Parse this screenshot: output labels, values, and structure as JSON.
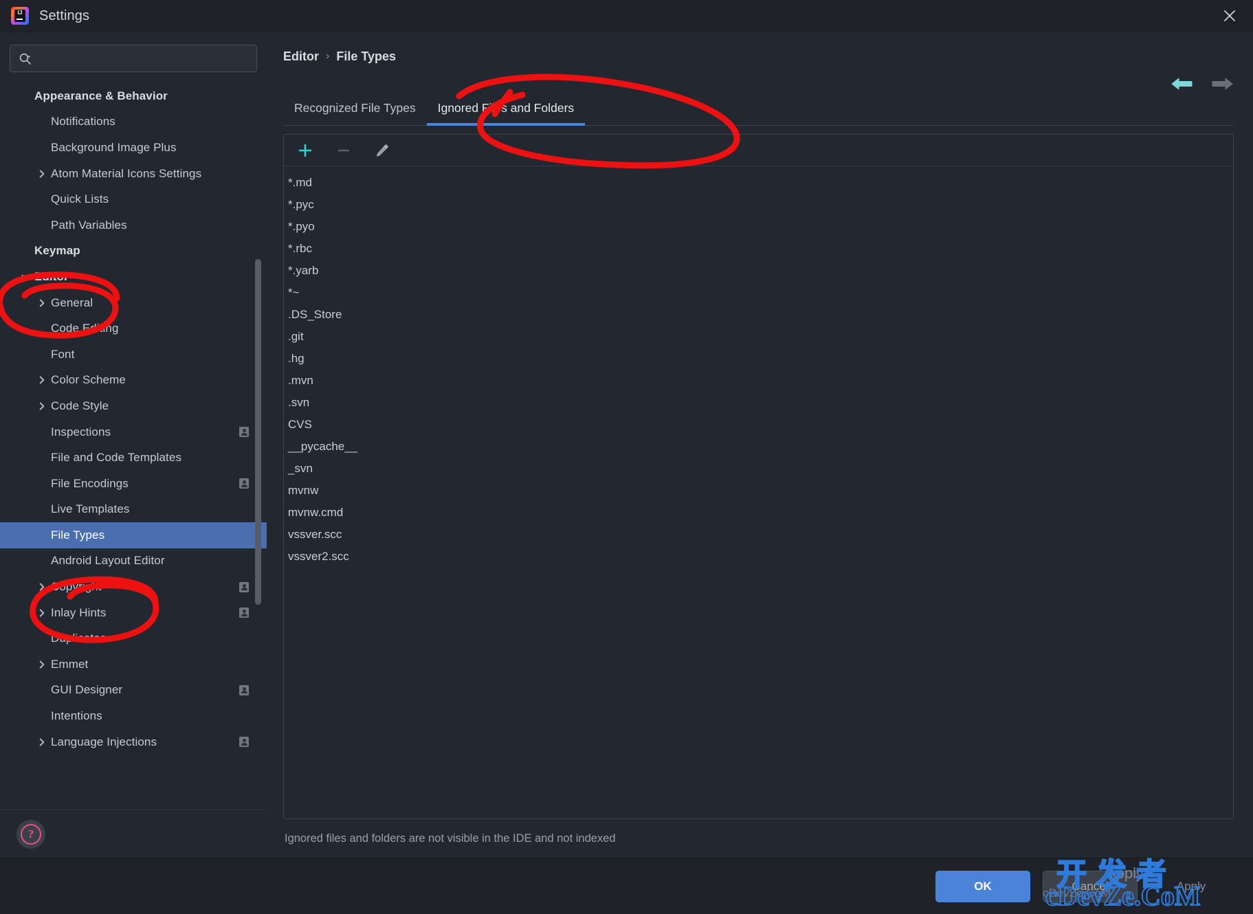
{
  "window": {
    "title": "Settings",
    "logo_icon": "intellij-idea-logo",
    "close_icon": "close-icon"
  },
  "search": {
    "placeholder": "",
    "value": "",
    "icon": "search-icon"
  },
  "sidebar": {
    "items": [
      {
        "label": "Appearance & Behavior",
        "level": 0,
        "arrow": "none",
        "group": true,
        "badge": false,
        "selected": false
      },
      {
        "label": "Notifications",
        "level": 1,
        "arrow": "none",
        "group": false,
        "badge": false,
        "selected": false
      },
      {
        "label": "Background Image Plus",
        "level": 1,
        "arrow": "none",
        "group": false,
        "badge": false,
        "selected": false
      },
      {
        "label": "Atom Material Icons Settings",
        "level": 1,
        "arrow": "collapsed",
        "group": false,
        "badge": false,
        "selected": false
      },
      {
        "label": "Quick Lists",
        "level": 1,
        "arrow": "none",
        "group": false,
        "badge": false,
        "selected": false
      },
      {
        "label": "Path Variables",
        "level": 1,
        "arrow": "none",
        "group": false,
        "badge": false,
        "selected": false
      },
      {
        "label": "Keymap",
        "level": 0,
        "arrow": "none",
        "group": true,
        "badge": false,
        "selected": false
      },
      {
        "label": "Editor",
        "level": 0,
        "arrow": "expanded",
        "group": true,
        "badge": false,
        "selected": false
      },
      {
        "label": "General",
        "level": 1,
        "arrow": "collapsed",
        "group": false,
        "badge": false,
        "selected": false
      },
      {
        "label": "Code Editing",
        "level": 1,
        "arrow": "none",
        "group": false,
        "badge": false,
        "selected": false
      },
      {
        "label": "Font",
        "level": 1,
        "arrow": "none",
        "group": false,
        "badge": false,
        "selected": false
      },
      {
        "label": "Color Scheme",
        "level": 1,
        "arrow": "collapsed",
        "group": false,
        "badge": false,
        "selected": false
      },
      {
        "label": "Code Style",
        "level": 1,
        "arrow": "collapsed",
        "group": false,
        "badge": false,
        "selected": false
      },
      {
        "label": "Inspections",
        "level": 1,
        "arrow": "none",
        "group": false,
        "badge": true,
        "selected": false
      },
      {
        "label": "File and Code Templates",
        "level": 1,
        "arrow": "none",
        "group": false,
        "badge": false,
        "selected": false
      },
      {
        "label": "File Encodings",
        "level": 1,
        "arrow": "none",
        "group": false,
        "badge": true,
        "selected": false
      },
      {
        "label": "Live Templates",
        "level": 1,
        "arrow": "none",
        "group": false,
        "badge": false,
        "selected": false
      },
      {
        "label": "File Types",
        "level": 1,
        "arrow": "none",
        "group": false,
        "badge": false,
        "selected": true
      },
      {
        "label": "Android Layout Editor",
        "level": 1,
        "arrow": "none",
        "group": false,
        "badge": false,
        "selected": false
      },
      {
        "label": "Copyright",
        "level": 1,
        "arrow": "collapsed",
        "group": false,
        "badge": true,
        "selected": false
      },
      {
        "label": "Inlay Hints",
        "level": 1,
        "arrow": "collapsed",
        "group": false,
        "badge": true,
        "selected": false
      },
      {
        "label": "Duplicates",
        "level": 1,
        "arrow": "none",
        "group": false,
        "badge": false,
        "selected": false
      },
      {
        "label": "Emmet",
        "level": 1,
        "arrow": "collapsed",
        "group": false,
        "badge": false,
        "selected": false
      },
      {
        "label": "GUI Designer",
        "level": 1,
        "arrow": "none",
        "group": false,
        "badge": true,
        "selected": false
      },
      {
        "label": "Intentions",
        "level": 1,
        "arrow": "none",
        "group": false,
        "badge": false,
        "selected": false
      },
      {
        "label": "Language Injections",
        "level": 1,
        "arrow": "collapsed",
        "group": false,
        "badge": true,
        "selected": false
      }
    ],
    "help_button": {
      "icon": "help-icon",
      "label": "?"
    }
  },
  "content": {
    "breadcrumb": {
      "parent": "Editor",
      "separator": "›",
      "current": "File Types"
    },
    "nav": {
      "back_icon": "arrow-left-icon",
      "forward_icon": "arrow-right-icon"
    },
    "tabs": [
      {
        "label": "Recognized File Types",
        "active": false
      },
      {
        "label": "Ignored Files and Folders",
        "active": true
      }
    ],
    "toolbar": [
      {
        "icon": "plus-icon",
        "name": "add-button",
        "enabled": true
      },
      {
        "icon": "minus-icon",
        "name": "remove-button",
        "enabled": false
      },
      {
        "icon": "pencil-icon",
        "name": "edit-button",
        "enabled": true
      }
    ],
    "ignored_entries": [
      "*.md",
      "*.pyc",
      "*.pyo",
      "*.rbc",
      "*.yarb",
      "*~",
      ".DS_Store",
      ".git",
      ".hg",
      ".mvn",
      ".svn",
      "CVS",
      "__pycache__",
      "_svn",
      "mvnw",
      "mvnw.cmd",
      "vssver.scc",
      "vssver2.scc"
    ],
    "hint": "Ignored files and folders are not visible in the IDE and not indexed"
  },
  "footer": {
    "ok_label": "OK",
    "cancel_label": "Cancel",
    "apply_label": "Apply"
  },
  "watermark": {
    "chinese": "开发者",
    "latin": "cDevZe.CoM"
  },
  "colors": {
    "accent_blue": "#4b83d8",
    "selection_blue": "#4b6eaf",
    "cyan": "#4fd3d8",
    "annotation_red": "#ee1111",
    "window_bg": "#232730",
    "titlebar_bg": "#1f2228",
    "help_pink": "#e8537f"
  }
}
